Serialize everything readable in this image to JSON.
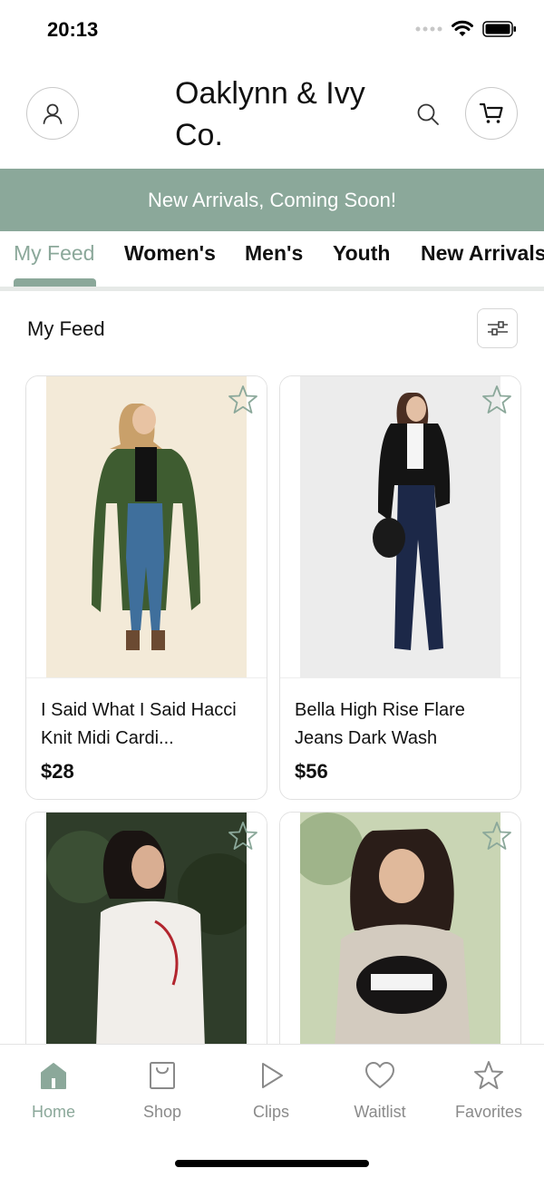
{
  "status": {
    "time": "20:13"
  },
  "header": {
    "brand": "Oaklynn & Ivy Co.",
    "profile_icon": "person-icon",
    "search_icon": "search-icon",
    "cart_icon": "cart-icon"
  },
  "banner": {
    "text": "New Arrivals, Coming Soon!"
  },
  "tabs": [
    {
      "label": "My Feed",
      "active": true
    },
    {
      "label": "Women's"
    },
    {
      "label": "Men's"
    },
    {
      "label": "Youth"
    },
    {
      "label": "New Arrivals"
    }
  ],
  "feed": {
    "title": "My Feed",
    "filter_icon": "sliders-icon",
    "products": [
      {
        "name": "I Said What I Said Hacci Knit Midi Cardi...",
        "price": "$28"
      },
      {
        "name": "Bella High Rise Flare Jeans Dark Wash",
        "price": "$56"
      },
      {
        "name": "",
        "price": ""
      },
      {
        "name": "",
        "price": ""
      }
    ]
  },
  "bottom_nav": [
    {
      "label": "Home",
      "icon": "home-icon",
      "active": true
    },
    {
      "label": "Shop",
      "icon": "bag-icon"
    },
    {
      "label": "Clips",
      "icon": "play-icon"
    },
    {
      "label": "Waitlist",
      "icon": "heart-icon"
    },
    {
      "label": "Favorites",
      "icon": "star-icon"
    }
  ],
  "colors": {
    "accent": "#8ba89a",
    "inactive": "#8a8a8a"
  }
}
